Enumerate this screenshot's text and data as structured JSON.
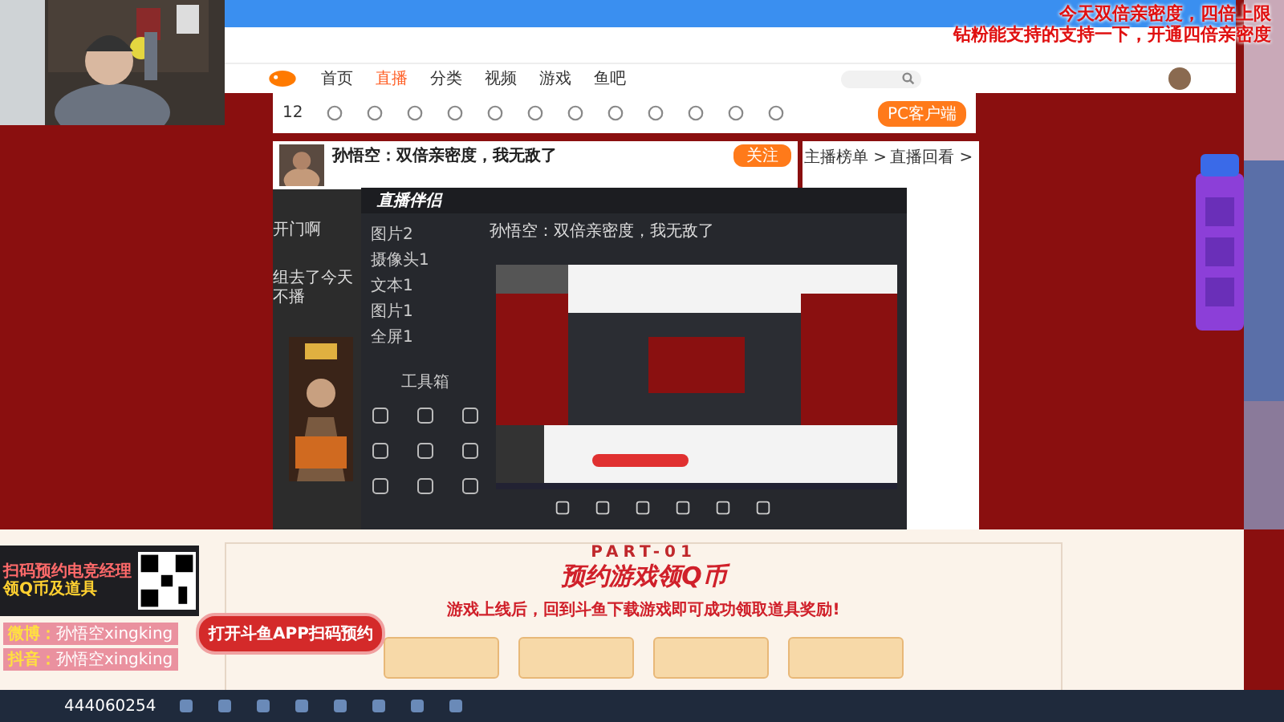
{
  "overlay_lines": [
    "今天双倍亲密度，四倍上限",
    "钻粉能支持的支持一下，开通四倍亲密度"
  ],
  "browser": {
    "nav": [
      {
        "label": "首页",
        "selected": false
      },
      {
        "label": "直播",
        "selected": true
      },
      {
        "label": "分类",
        "selected": false
      },
      {
        "label": "视频",
        "selected": false
      },
      {
        "label": "游戏",
        "selected": false
      },
      {
        "label": "鱼吧",
        "selected": false
      }
    ],
    "coins": "12",
    "client_button": "PC客户端"
  },
  "stream": {
    "title": "孙悟空：双倍亲密度，我无敌了",
    "follow_button": "关注"
  },
  "side_texts": [
    "开门啊",
    "组去了今天不播"
  ],
  "chat": {
    "tabs": [
      "主播榜单 >",
      "直播回看 >"
    ]
  },
  "studio": {
    "logo": "直播伴侣",
    "title": "孙悟空：双倍亲密度，我无敌了",
    "layers": [
      {
        "label": "图片2",
        "visible": true
      },
      {
        "label": "摄像头1",
        "visible": true
      },
      {
        "label": "文本1",
        "visible": true
      },
      {
        "label": "图片1",
        "visible": true
      },
      {
        "label": "全屏1",
        "visible": true
      }
    ],
    "toolbox": "工具箱"
  },
  "promo": {
    "part": "PART-01",
    "heading": "预约游戏领Q币",
    "subtitle": "游戏上线后，回到斗鱼下载游戏即可成功领取道具奖励!",
    "button": "打开斗鱼APP扫码预约"
  },
  "qr_card": {
    "lines": [
      "扫码预约电竞经理",
      "领Q币及道具"
    ]
  },
  "socials": [
    {
      "label": "微博：",
      "value": "孙悟空xingking"
    },
    {
      "label": "抖音：",
      "value": "孙悟空xingking"
    }
  ],
  "viewer_id": "444060254"
}
